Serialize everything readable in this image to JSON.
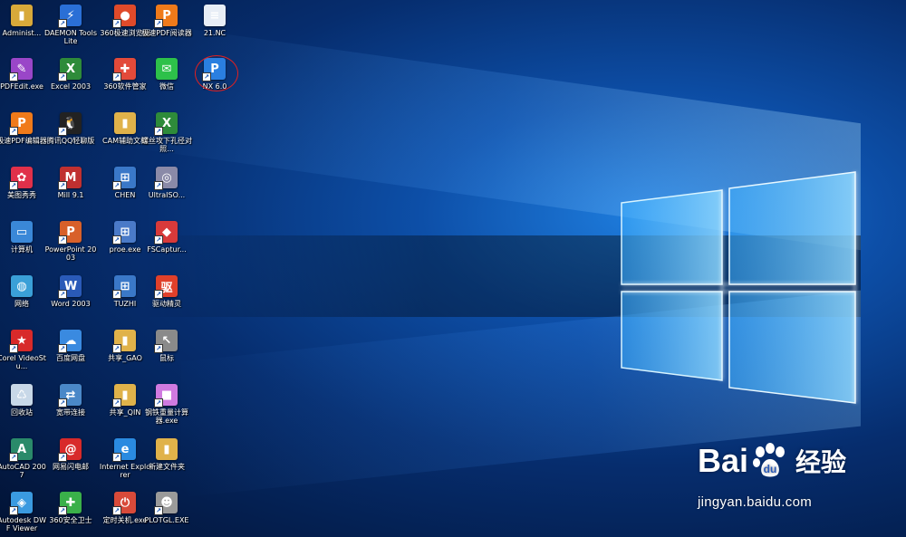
{
  "desktop": {
    "icons": [
      {
        "label": "Administ...",
        "icon": "folder-user-icon",
        "color": "#d8a93a",
        "glyph": "▮"
      },
      {
        "label": "DAEMON Tools Lite",
        "icon": "daemon-tools-icon",
        "color": "#2a6fd6",
        "glyph": "⚡"
      },
      {
        "label": "360极速浏览器",
        "icon": "browser-360-icon",
        "color": "#e04a2a",
        "glyph": "●"
      },
      {
        "label": "极速PDF阅读器",
        "icon": "pdf-reader-icon",
        "color": "#f07a1a",
        "glyph": "P"
      },
      {
        "label": "21.NC",
        "icon": "nc-file-icon",
        "color": "#e8eef6",
        "glyph": "≡"
      },
      {
        "label": "PDFEdit.exe",
        "icon": "pdfedit-icon",
        "color": "#9a46c8",
        "glyph": "✎"
      },
      {
        "label": "Excel 2003",
        "icon": "excel-icon",
        "color": "#2e8b3a",
        "glyph": "X"
      },
      {
        "label": "360软件管家",
        "icon": "software-manager-360-icon",
        "color": "#e24a3a",
        "glyph": "✚"
      },
      {
        "label": "微信",
        "icon": "wechat-icon",
        "color": "#2dc14a",
        "glyph": "✉"
      },
      {
        "label": "NX 6.0",
        "icon": "nx-icon",
        "color": "#2a7fe0",
        "glyph": "P"
      },
      {
        "label": "极速PDF编辑器",
        "icon": "pdf-editor-icon",
        "color": "#f07a1a",
        "glyph": "P"
      },
      {
        "label": "腾讯QQ轻聊版",
        "icon": "qq-icon",
        "color": "#222222",
        "glyph": "🐧"
      },
      {
        "label": "CAM辅助文档",
        "icon": "folder-icon",
        "color": "#e0b24a",
        "glyph": "▮"
      },
      {
        "label": "螺丝攻下孔径对照...",
        "icon": "excel-file-icon",
        "color": "#2e8b3a",
        "glyph": "X"
      },
      {
        "label": "美图秀秀",
        "icon": "meitu-icon",
        "color": "#e0304a",
        "glyph": "✿"
      },
      {
        "label": "Mill 9.1",
        "icon": "mastercam-mill-icon",
        "color": "#c03030",
        "glyph": "M"
      },
      {
        "label": "CHEN",
        "icon": "chen-shortcut-icon",
        "color": "#3a78c8",
        "glyph": "⊞"
      },
      {
        "label": "UltraISO...",
        "icon": "ultraiso-icon",
        "color": "#8a8aa8",
        "glyph": "◎"
      },
      {
        "label": "计算机",
        "icon": "computer-icon",
        "color": "#3a88d8",
        "glyph": "▭"
      },
      {
        "label": "PowerPoint 2003",
        "icon": "powerpoint-icon",
        "color": "#d8602a",
        "glyph": "P"
      },
      {
        "label": "proe.exe",
        "icon": "proe-icon",
        "color": "#4a7ac8",
        "glyph": "⊞"
      },
      {
        "label": "FSCaptur...",
        "icon": "fscapture-icon",
        "color": "#d83a3a",
        "glyph": "◆"
      },
      {
        "label": "网络",
        "icon": "network-icon",
        "color": "#3aa0d8",
        "glyph": "◍"
      },
      {
        "label": "Word 2003",
        "icon": "word-icon",
        "color": "#2a5ab8",
        "glyph": "W"
      },
      {
        "label": "TUZHI",
        "icon": "tuzhi-shortcut-icon",
        "color": "#3a78c8",
        "glyph": "⊞"
      },
      {
        "label": "驱动精灵",
        "icon": "driver-genius-icon",
        "color": "#e0402a",
        "glyph": "驱"
      },
      {
        "label": "Corel VideoStu...",
        "icon": "corel-video-icon",
        "color": "#d82a2a",
        "glyph": "★"
      },
      {
        "label": "百度网盘",
        "icon": "baidu-netdisk-icon",
        "color": "#3a8ae0",
        "glyph": "☁"
      },
      {
        "label": "共享_GAO",
        "icon": "shared-folder-icon",
        "color": "#e0b24a",
        "glyph": "▮"
      },
      {
        "label": "鼠标",
        "icon": "mouse-icon",
        "color": "#8a8a8a",
        "glyph": "↖"
      },
      {
        "label": "回收站",
        "icon": "recycle-bin-icon",
        "color": "#c8d8e8",
        "glyph": "♺"
      },
      {
        "label": "宽带连接",
        "icon": "broadband-connection-icon",
        "color": "#4a88c8",
        "glyph": "⇄"
      },
      {
        "label": "共享_QIN",
        "icon": "shared-folder-icon",
        "color": "#e0b24a",
        "glyph": "▮"
      },
      {
        "label": "钢铁重量计算器.exe",
        "icon": "calculator-cube-icon",
        "color": "#d07ae0",
        "glyph": "■"
      },
      {
        "label": "AutoCAD 2007",
        "icon": "autocad-icon",
        "color": "#2a8a6a",
        "glyph": "A"
      },
      {
        "label": "网易闪电邮",
        "icon": "netease-mail-icon",
        "color": "#d82a2a",
        "glyph": "@"
      },
      {
        "label": "Internet Explorer",
        "icon": "internet-explorer-icon",
        "color": "#2a8ae0",
        "glyph": "e"
      },
      {
        "label": "新建文件夹",
        "icon": "new-folder-icon",
        "color": "#e0b24a",
        "glyph": "▮"
      },
      {
        "label": "Autodesk DWF Viewer",
        "icon": "dwf-viewer-icon",
        "color": "#3a9ae0",
        "glyph": "◈"
      },
      {
        "label": "360安全卫士",
        "icon": "security-360-icon",
        "color": "#3ab04a",
        "glyph": "✚"
      },
      {
        "label": "定时关机.exe",
        "icon": "timer-shutdown-icon",
        "color": "#d84a3a",
        "glyph": "⏻"
      },
      {
        "label": "PLOTGL.EXE",
        "icon": "plotgl-icon",
        "color": "#9a9a9a",
        "glyph": "☻"
      }
    ]
  },
  "watermark": {
    "brand_left": "Bai",
    "brand_right": "经验",
    "url": "jingyan.baidu.com"
  }
}
